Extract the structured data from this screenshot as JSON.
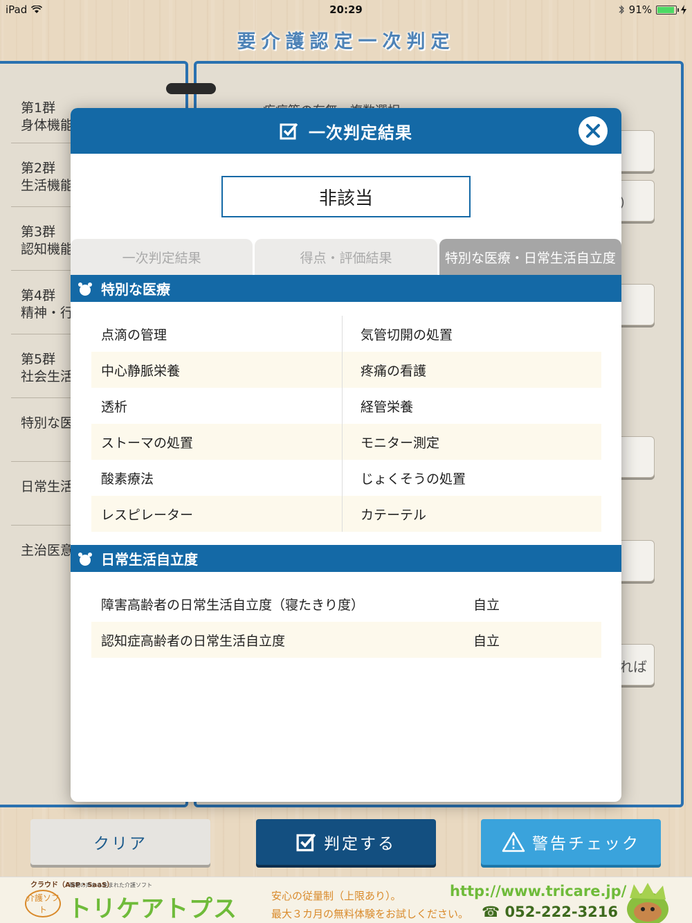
{
  "status_bar": {
    "device": "iPad",
    "time": "20:29",
    "battery": "91%",
    "battery_level": 0.91
  },
  "app_title": "要介護認定一次判定",
  "background": {
    "groups": [
      {
        "line1": "第1群",
        "line2": "身体機能"
      },
      {
        "line1": "第2群",
        "line2": "生活機能"
      },
      {
        "line1": "第3群",
        "line2": "認知機能"
      },
      {
        "line1": "第4群",
        "line2": "精神・行"
      },
      {
        "line1": "第5群",
        "line2": "社会生活"
      },
      {
        "line1": "特別な医",
        "line2": ""
      },
      {
        "line1": "日常生活",
        "line2": ""
      },
      {
        "line1": "主治医意",
        "line2": ""
      }
    ],
    "heading_partial": "疾病等の有無　複数選択",
    "side_text_1": "）",
    "side_text_2": "れば"
  },
  "modal": {
    "title": "一次判定結果",
    "result": "非該当",
    "tabs": [
      {
        "label": "一次判定結果",
        "active": false
      },
      {
        "label": "得点・評価結果",
        "active": false
      },
      {
        "label": "特別な医療・日常生活自立度",
        "active": true
      }
    ],
    "special_medical": {
      "heading": "特別な医療",
      "rows": [
        [
          "点滴の管理",
          "気管切開の処置"
        ],
        [
          "中心静脈栄養",
          "疼痛の看護"
        ],
        [
          "透析",
          "経管栄養"
        ],
        [
          "ストーマの処置",
          "モニター測定"
        ],
        [
          "酸素療法",
          "じょくそうの処置"
        ],
        [
          "レスピレーター",
          "カテーテル"
        ]
      ]
    },
    "adl": {
      "heading": "日常生活自立度",
      "rows": [
        {
          "label": "障害高齢者の日常生活自立度（寝たきり度）",
          "value": "自立"
        },
        {
          "label": "認知症高齢者の日常生活自立度",
          "value": "自立"
        }
      ]
    }
  },
  "buttons": {
    "clear": "クリア",
    "judge": "判定する",
    "warning": "警告チェック"
  },
  "footer": {
    "cloud": "クラウド（ASP・SaaS）",
    "badge": "介護ソフト",
    "tagline": "現場の声から生まれた介護ソフト",
    "logo": "トリケアトプス",
    "copy1": "安心の従量制（上限あり）。",
    "copy2": "最大３カ月の無料体験をお試しください。",
    "url": "http://www.tricare.jp/",
    "phone": "☎ 052-222-3216"
  },
  "colors": {
    "primary": "#1469a6",
    "dark_button": "#134f80",
    "warning_button": "#3aa3dc",
    "row_highlight": "#fdf9ec",
    "active_tab": "#a6a6a6"
  }
}
